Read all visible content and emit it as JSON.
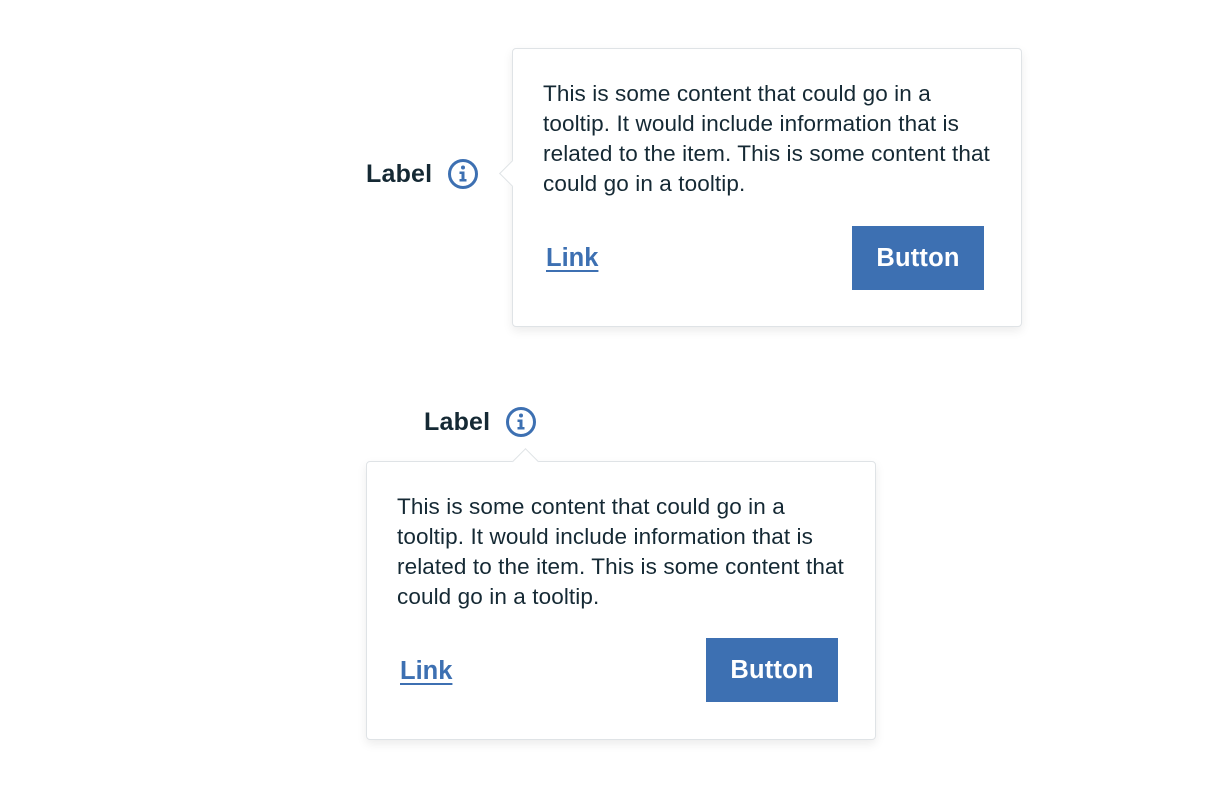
{
  "colors": {
    "accent": "#3d70b2",
    "text": "#152934",
    "border": "#dfe3e6",
    "background": "#ffffff"
  },
  "tooltips": [
    {
      "placement": "right",
      "label": "Label",
      "icon": "info-icon",
      "content": "This is some content that could go in a tooltip. It would include information that is related to the item. This is some content that could go in a tooltip.",
      "link_label": "Link",
      "button_label": "Button"
    },
    {
      "placement": "bottom",
      "label": "Label",
      "icon": "info-icon",
      "content": "This is some content that could go in a tooltip. It would include information that is related to the item. This is some content that could go in a tooltip.",
      "link_label": "Link",
      "button_label": "Button"
    }
  ]
}
